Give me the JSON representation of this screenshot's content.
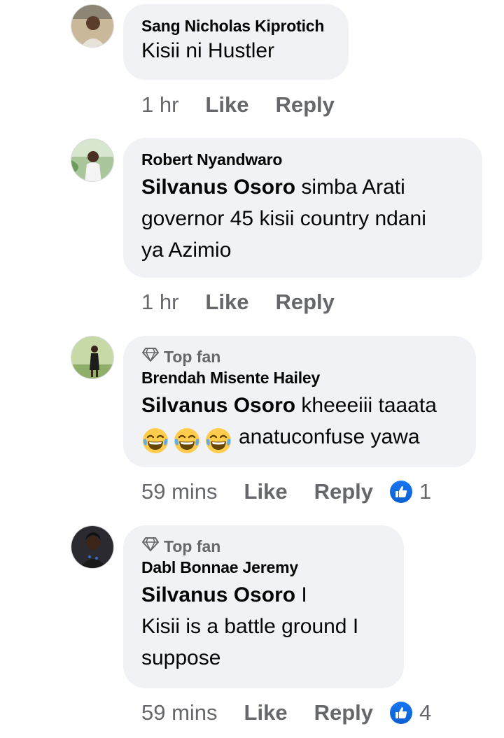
{
  "comments": [
    {
      "author": "Sang Nicholas Kiprotich",
      "top_fan": false,
      "mention": "",
      "lines": [
        "Kisii ni Hustler"
      ],
      "time": "1 hr",
      "like_label": "Like",
      "reply_label": "Reply",
      "reaction_count": ""
    },
    {
      "author": "Robert Nyandwaro",
      "top_fan": false,
      "mention": "Silvanus Osoro",
      "lines": [
        " simba Arati",
        "governor 45 kisii country ndani",
        "ya Azimio"
      ],
      "time": "1 hr",
      "like_label": "Like",
      "reply_label": "Reply",
      "reaction_count": ""
    },
    {
      "author": "Brendah Misente Hailey",
      "top_fan": true,
      "top_fan_label": "Top fan",
      "mention": "Silvanus Osoro",
      "lines": [
        " kheeeiii taaata",
        "anatuconfuse yawa"
      ],
      "emoji": "face-with-tears-of-joy",
      "emoji_count": 3,
      "time": "59 mins",
      "like_label": "Like",
      "reply_label": "Reply",
      "reaction_count": "1"
    },
    {
      "author": "Dabl Bonnae Jeremy",
      "top_fan": true,
      "top_fan_label": "Top fan",
      "mention": "Silvanus Osoro",
      "lines": [
        " I",
        "Kisii is a battle ground I",
        "suppose"
      ],
      "time": "59 mins",
      "like_label": "Like",
      "reply_label": "Reply",
      "reaction_count": "4"
    }
  ],
  "colors": {
    "bubble": "#f0f2f5",
    "meta_text": "#65676b",
    "like_blue": "#1877f2",
    "emoji_yellow": "#ffcc4d"
  },
  "icons": [
    "diamond-icon",
    "like-thumb-icon",
    "laughing-emoji-icon"
  ]
}
